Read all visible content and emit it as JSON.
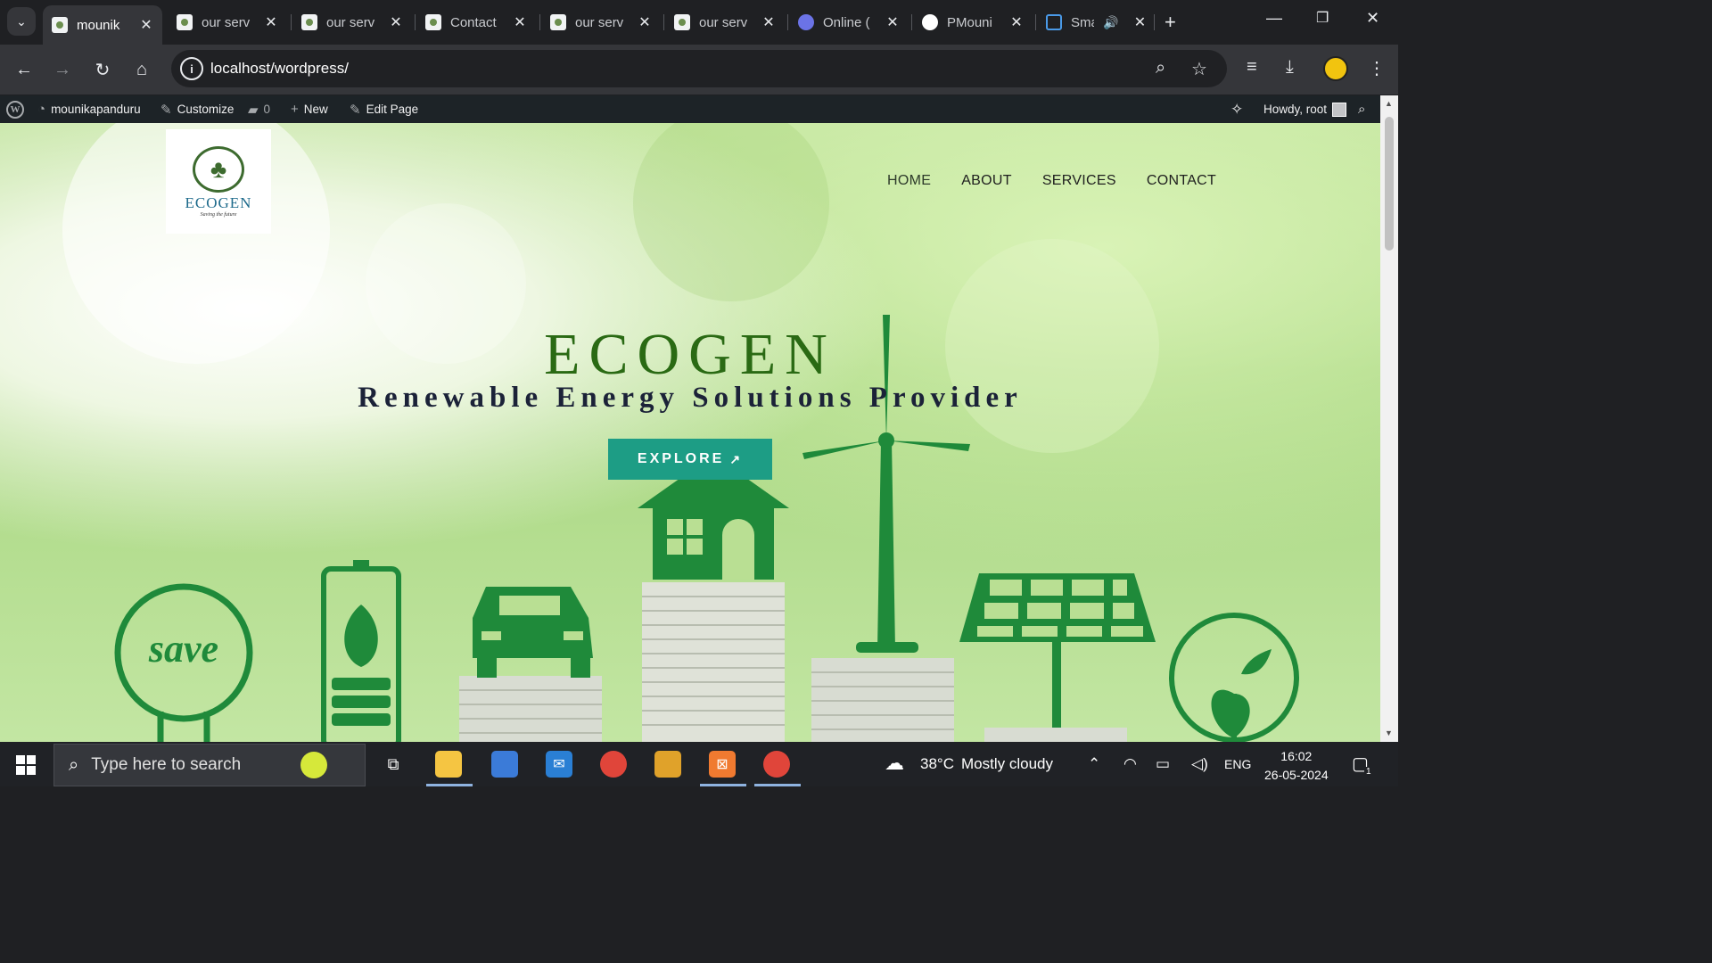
{
  "browser": {
    "tabs": [
      {
        "title": "mounik",
        "active": true
      },
      {
        "title": "our serv",
        "active": false
      },
      {
        "title": "our serv",
        "active": false
      },
      {
        "title": "Contact",
        "active": false
      },
      {
        "title": "our serv",
        "active": false
      },
      {
        "title": "our serv",
        "active": false
      },
      {
        "title": "Online (",
        "active": false
      },
      {
        "title": "PMouni",
        "active": false
      },
      {
        "title": "Sma",
        "active": false
      }
    ],
    "url": "localhost/wordpress/"
  },
  "adminbar": {
    "site": "mounikapanduru",
    "customize": "Customize",
    "comments": "0",
    "new": "New",
    "edit": "Edit Page",
    "howdy": "Howdy, root"
  },
  "site": {
    "logo_name": "ECOGEN",
    "logo_tagline": "Saving the future",
    "nav": [
      "HOME",
      "ABOUT",
      "SERVICES",
      "CONTACT"
    ],
    "hero_title": "ECOGEN",
    "hero_subtitle": "Renewable Energy Solutions Provider",
    "cta": "EXPLORE",
    "illustration_word": "save"
  },
  "taskbar": {
    "search_placeholder": "Type here to search",
    "weather_temp": "38°C",
    "weather_text": "Mostly cloudy",
    "lang": "ENG",
    "time": "16:02",
    "date": "26-05-2024",
    "notifications": "1"
  },
  "colors": {
    "accent_button": "#1d9d85",
    "hero_title": "#2a6a14",
    "hero_subtitle": "#1b2238",
    "illustration": "#1f8a3a"
  }
}
